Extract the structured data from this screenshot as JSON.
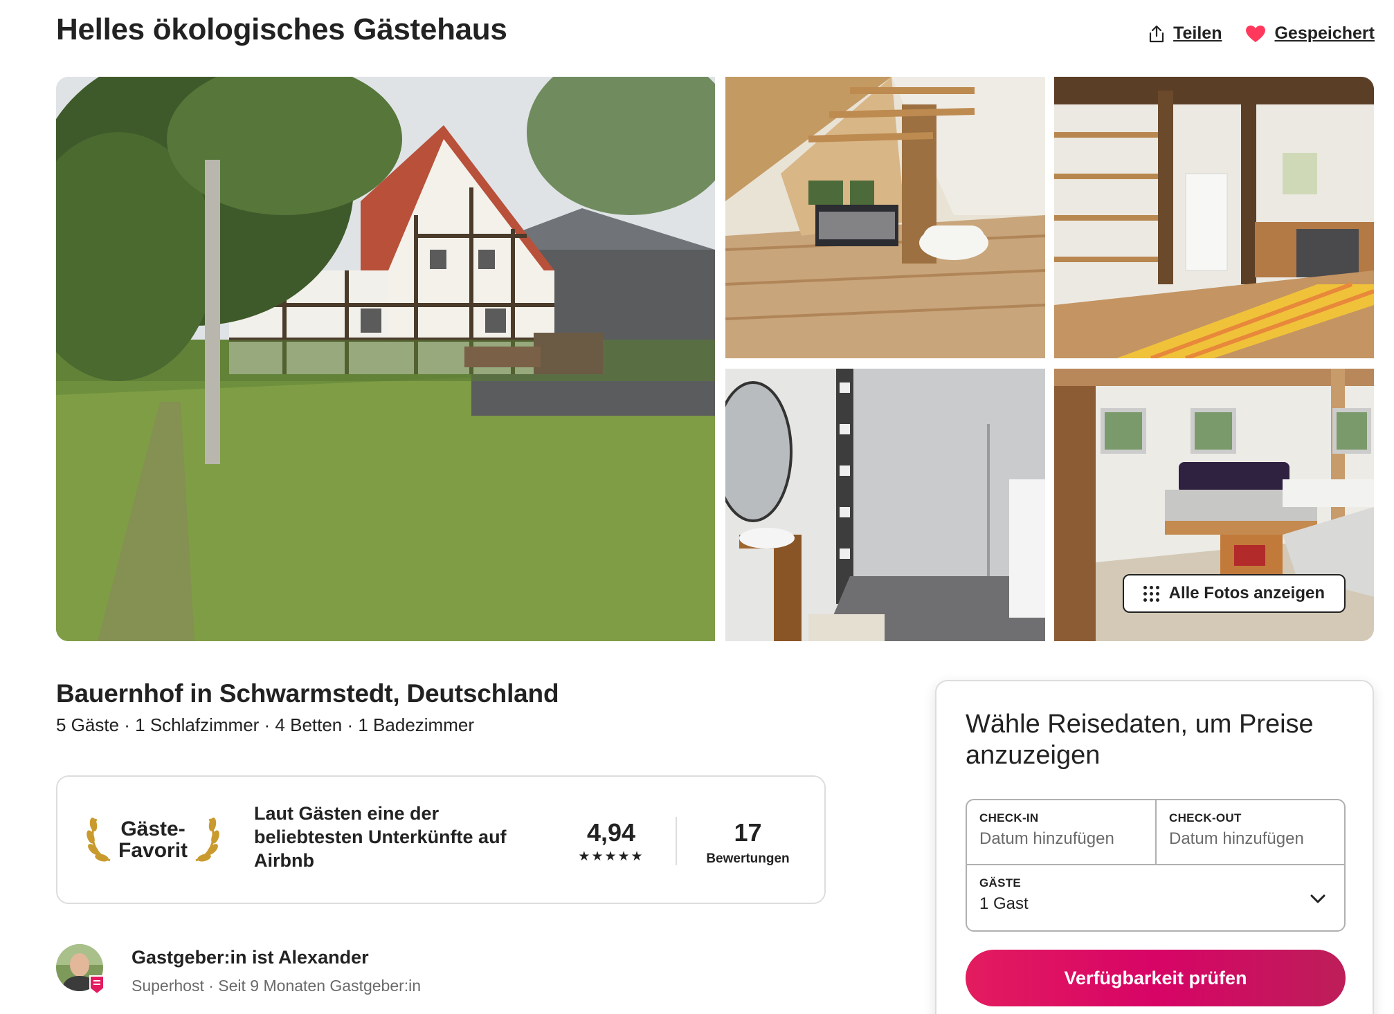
{
  "listing": {
    "title": "Helles ökologisches Gästehaus",
    "subtitle": "Bauernhof in Schwarmstedt, Deutschland",
    "details": "5 Gäste · 1 Schlafzimmer · 4 Betten · 1 Badezimmer"
  },
  "header_actions": {
    "share_label": "Teilen",
    "save_label": "Gespeichert",
    "save_color": "#ff385c"
  },
  "gallery": {
    "show_all_label": "Alle Fotos anzeigen",
    "photos": [
      "house-exterior-photo",
      "attic-bedroom-photo",
      "kitchen-photo",
      "bathroom-photo",
      "living-room-photo"
    ]
  },
  "guest_favorite": {
    "badge_line1": "Gäste-",
    "badge_line2": "Favorit",
    "description": "Laut Gästen eine der beliebtesten Unterkünfte auf Airbnb",
    "rating": "4,94",
    "stars": "★★★★★",
    "review_count": "17",
    "review_label": "Bewertungen"
  },
  "host": {
    "name": "Gastgeber:in ist Alexander",
    "meta": "Superhost · Seit 9 Monaten Gastgeber:in"
  },
  "booking": {
    "heading": "Wähle Reisedaten, um Preise anzuzeigen",
    "checkin_label": "CHECK-IN",
    "checkin_placeholder": "Datum hinzufügen",
    "checkout_label": "CHECK-OUT",
    "checkout_placeholder": "Datum hinzufügen",
    "guests_label": "GÄSTE",
    "guests_value": "1 Gast",
    "button_label": "Verfügbarkeit prüfen",
    "accent_color": "#e31c5f"
  }
}
